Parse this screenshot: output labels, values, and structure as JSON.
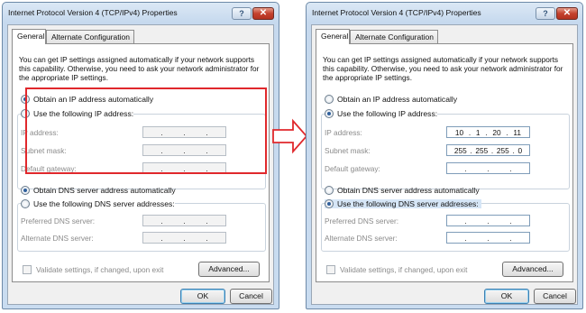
{
  "colors": {
    "highlight_box": "#e0282c",
    "window_frame": "#c6d9ee",
    "dialog_bg": "#f0f0f0",
    "arrow": "#e0282c"
  },
  "left": {
    "title": "Internet Protocol Version 4 (TCP/IPv4) Properties",
    "help": "?",
    "close": "✕",
    "tab_general": "General",
    "tab_alt": "Alternate Configuration",
    "intro": "You can get IP settings assigned automatically if your network supports this capability. Otherwise, you need to ask your network administrator for the appropriate IP settings.",
    "radio_auto_ip": "Obtain an IP address automatically",
    "radio_manual_ip": "Use the following IP address:",
    "label_ip": "IP address:",
    "label_mask": "Subnet mask:",
    "label_gateway": "Default gateway:",
    "radio_auto_dns": "Obtain DNS server address automatically",
    "radio_manual_dns": "Use the following DNS server addresses:",
    "label_pref_dns": "Preferred DNS server:",
    "label_alt_dns": "Alternate DNS server:",
    "validate": "Validate settings, if changed, upon exit",
    "advanced": "Advanced...",
    "ok": "OK",
    "cancel": "Cancel"
  },
  "right": {
    "title": "Internet Protocol Version 4 (TCP/IPv4) Properties",
    "help": "?",
    "close": "✕",
    "tab_general": "General",
    "tab_alt": "Alternate Configuration",
    "intro": "You can get IP settings assigned automatically if your network supports this capability. Otherwise, you need to ask your network administrator for the appropriate IP settings.",
    "radio_auto_ip": "Obtain an IP address automatically",
    "radio_manual_ip": "Use the following IP address:",
    "label_ip": "IP address:",
    "label_mask": "Subnet mask:",
    "label_gateway": "Default gateway:",
    "ip_value": [
      "10",
      "1",
      "20",
      "11"
    ],
    "mask_value": [
      "255",
      "255",
      "255",
      "0"
    ],
    "radio_auto_dns": "Obtain DNS server address automatically",
    "radio_manual_dns": "Use the following DNS server addresses:",
    "label_pref_dns": "Preferred DNS server:",
    "label_alt_dns": "Alternate DNS server:",
    "validate": "Validate settings, if changed, upon exit",
    "advanced": "Advanced...",
    "ok": "OK",
    "cancel": "Cancel"
  }
}
